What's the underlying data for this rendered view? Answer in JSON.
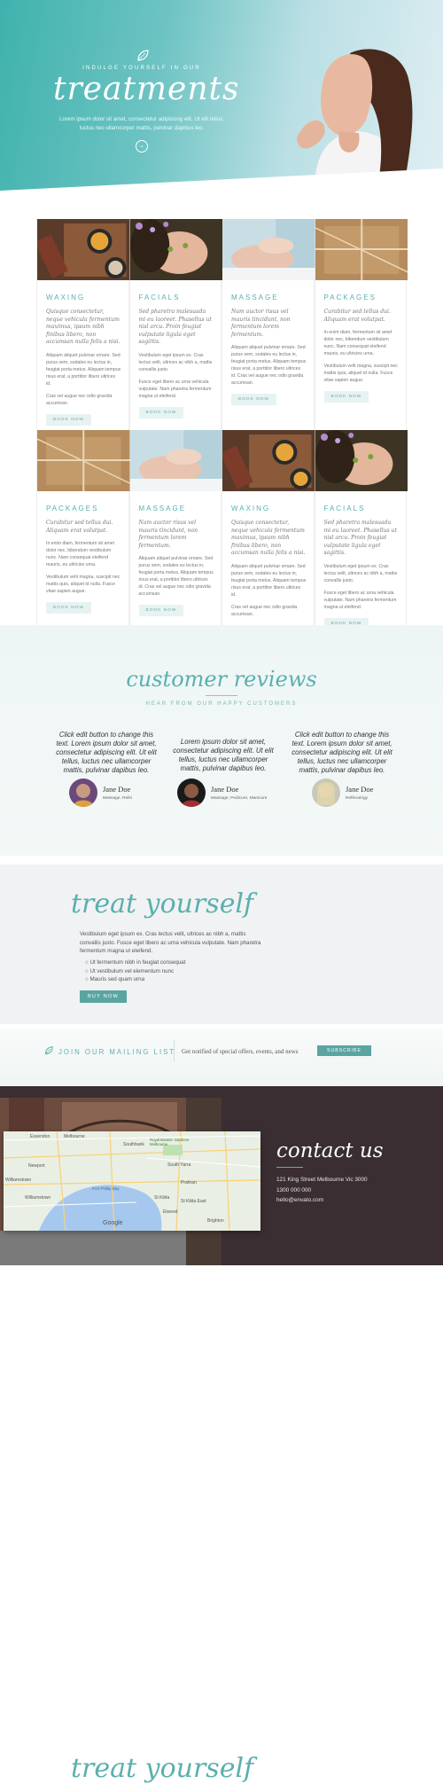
{
  "hero": {
    "kicker": "INDULGE YOURSELF IN OUR",
    "title": "treatments",
    "intro": "Lorem ipsum dolor sit amet, consectetur adipiscing elit. Ut elit tellus, luctus nec ullamcorper mattis, pulvinar dapibus leo.",
    "chevron": "⌄"
  },
  "treatments_row1": [
    {
      "name": "WAXING",
      "lead": "Quisque consectetur, neque vehicula fermentum maximus, ipsum nibh finibus libero, non accumsan nulla felis a nisi.",
      "body1": "Aliquam aliquet pulvinar ornare. Sed purus sem, sodales eu lectus in, feugiat porta metus. Aliquam tempus risus erat, a porttitor libero ultrices id.",
      "body2": "Cras vel augue nec odio gravida accumsan.",
      "button": "BOOK NOW"
    },
    {
      "name": "FACIALS",
      "lead": "Sed pharetra malesuada mi eu laoreet. Phasellus ut nisl arcu. Proin feugiat vulputate ligula eget sagittis.",
      "body1": "Vestibulum eget ipsum ex. Cras lectus velit, ultrices ac nibh a, mattis convallis justo.",
      "body2": "Fusce eget libero ac urna vehicula vulputate. Nam pharetra fermentum magna ut eleifend.",
      "button": "BOOK NOW"
    },
    {
      "name": "MASSAGE",
      "lead": "Nam auctor risus vel mauris tincidunt, non fermentum lorem fermentum.",
      "body1": "Aliquam aliquet pulvinar ornare. Sed purus sem, sodales eu lectus in, feugiat porta metus. Aliquam tempus risus erat, a porttitor libero ultrices id. Cras vel augue nec odio gravida accumsan.",
      "body2": "",
      "button": "BOOK NOW"
    },
    {
      "name": "PACKAGES",
      "lead": "Curabitur sed tellus dui. Aliquam erat volutpat.",
      "body1": "In enim diam, fermentum sit amet dolor nec, bibendum vestibulum nunc. Nam consequat eleifend mauris, eu ultricies urna.",
      "body2": "Vestibulum velit magna, suscipit nec mattis quis, aliquet id nulla. Fusce vitae sapien augue.",
      "button": "BOOK NOW"
    }
  ],
  "treatments_row2": [
    {
      "name": "PACKAGES",
      "lead": "Curabitur sed tellus dui. Aliquam erat volutpat.",
      "body1": "In enim diam, fermentum sit amet dolor nec, bibendum vestibulum nunc. Nam consequat eleifend mauris, eu ultricies urna.",
      "body2": "Vestibulum velit magna, suscipit nec mattis quis, aliquet id nulla. Fusce vitae sapien augue.",
      "button": "BOOK NOW"
    },
    {
      "name": "MASSAGE",
      "lead": "Nam auctor risus vel mauris tincidunt, non fermentum lorem fermentum.",
      "body1": "Aliquam aliquet pulvinar ornare. Sed purus sem, sodales eu lectus in, feugiat porta metus. Aliquam tempus risus erat, a porttitor libero ultrices id. Cras vel augue nec odio gravida accumsan.",
      "body2": "",
      "button": "BOOK NOW"
    },
    {
      "name": "WAXING",
      "lead": "Quisque consectetur, neque vehicula fermentum maximus, ipsum nibh finibus libero, non accumsan nulla felis a nisi.",
      "body1": "Aliquam aliquet pulvinar ornare. Sed purus sem, sodales eu lectus in, feugiat porta metus. Aliquam tempus risus erat, a porttitor libero ultrices id.",
      "body2": "Cras vel augue nec odio gravida accumsan.",
      "button": "BOOK NOW"
    },
    {
      "name": "FACIALS",
      "lead": "Sed pharetra malesuada mi eu laoreet. Phasellus ut nisl arcu. Proin feugiat vulputate ligula eget sagittis.",
      "body1": "Vestibulum eget ipsum ex. Cras lectus velit, ultrices ac nibh a, mattis convallis justo.",
      "body2": "Fusce eget libero ac urna vehicula vulputate. Nam pharetra fermentum magna ut eleifend.",
      "button": "BOOK NOW"
    }
  ],
  "reviews": {
    "title": "customer reviews",
    "subtitle": "HEAR FROM OUR HAPPY CUSTOMERS",
    "items": [
      {
        "quote": "Click edit button to change this text. Lorem ipsum dolor sit amet, consectetur adipiscing elit. Ut elit tellus, luctus nec ullamcorper mattis, pulvinar dapibus leo.",
        "name": "Jane Doe",
        "role": "Massage, Reiki"
      },
      {
        "quote": "Lorem ipsum dolor sit amet, consectetur adipiscing elit. Ut elit tellus, luctus nec ullamcorper mattis, pulvinar dapibus leo.",
        "name": "Jane Doe",
        "role": "Massage, Pedicure, Manicure"
      },
      {
        "quote": "Click edit button to change this text. Lorem ipsum dolor sit amet, consectetur adipiscing elit. Ut elit tellus, luctus nec ullamcorper mattis, pulvinar dapibus leo.",
        "name": "Jane Doe",
        "role": "Reflexology"
      }
    ]
  },
  "treat": {
    "title": "treat yourself",
    "para": "Vestibulum eget ipsum ex. Cras lectus velit, ultrices ac nibh a, mattis convallis justo. Fusce eget libero ac urna vehicula vulputate. Nam pharetra fermentum magna ut eleifend.",
    "bullets": [
      "Ut fermentum nibh in feugiat consequat",
      "Ut vestibulum vel elementum nunc",
      "Mauris sed quam urna"
    ],
    "button": "BUY NOW"
  },
  "mailing": {
    "label": "JOIN OUR MAILING LIST",
    "text": "Get notified of special offers, events, and news",
    "button": "SUBSCRIBE"
  },
  "contact": {
    "title": "contact us",
    "address": "121 King Street Melbourne Vic 3000",
    "phone": "1300 000 000",
    "email": "hello@envato.com"
  },
  "map": {
    "brand": "Google",
    "labels": [
      "Essendon",
      "Melbourne",
      "Newport",
      "Williamstown",
      "Williamstown",
      "Port Phillip Bay",
      "South Yarra",
      "Prahran",
      "St Kilda",
      "St Kilda East",
      "Elwood",
      "Brighton",
      "Royal Botanic Gardens Melbourne",
      "Southbank"
    ]
  }
}
